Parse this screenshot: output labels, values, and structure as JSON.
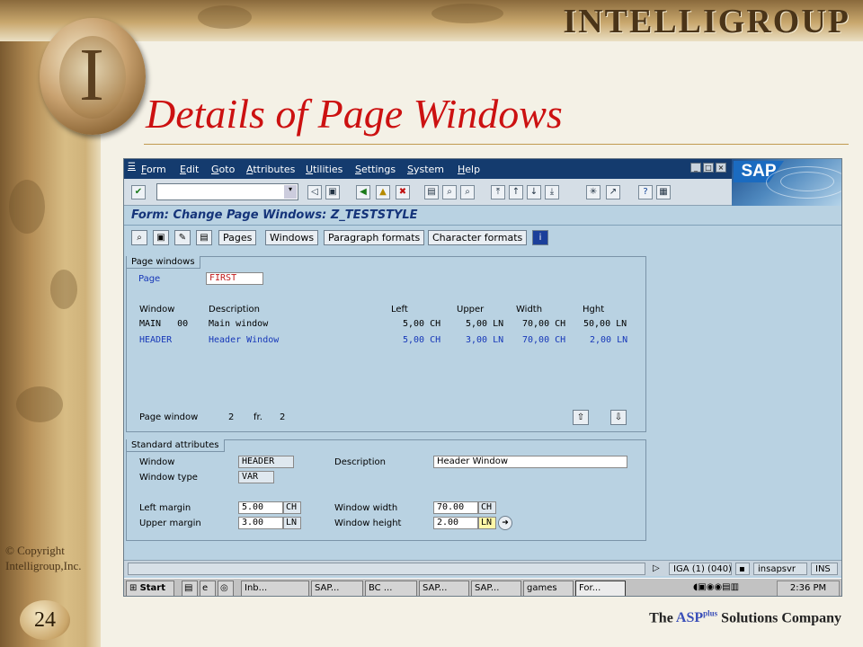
{
  "slide": {
    "brand": "INTELLIGROUP",
    "title": "Details of Page Windows",
    "copyright_line1": "© Copyright",
    "copyright_line2": "Intelligroup,Inc.",
    "page_number": "24",
    "tagline_the": "The ",
    "tagline_asp": "ASP",
    "tagline_plus": "plus",
    "tagline_rest": " Solutions Company"
  },
  "sap": {
    "menu": [
      "Form",
      "Edit",
      "Goto",
      "Attributes",
      "Utilities",
      "Settings",
      "System",
      "Help"
    ],
    "logo_text": "SAP",
    "command_value": "",
    "screen_title": "Form: Change Page Windows: Z_TESTSTYLE",
    "app_buttons": [
      "Pages",
      "Windows",
      "Paragraph formats",
      "Character formats"
    ],
    "page_windows": {
      "group_label": "Page windows",
      "page_label": "Page",
      "page_value": "FIRST",
      "columns": [
        "Window",
        "Description",
        "Left",
        "Upper",
        "Width",
        "Hght"
      ],
      "rows": [
        {
          "window": "MAIN   00",
          "description": "Main window",
          "left": "5,00 CH",
          "upper": "5,00 LN",
          "width": "70,00 CH",
          "height": "50,00 LN",
          "highlight": false
        },
        {
          "window": "HEADER",
          "description": "Header Window",
          "left": "5,00 CH",
          "upper": "3,00 LN",
          "width": "70,00 CH",
          "height": "2,00 LN",
          "highlight": true
        }
      ],
      "footer_label": "Page window",
      "footer_current": "2",
      "footer_fr": "fr.",
      "footer_total": "2"
    },
    "standard_attributes": {
      "group_label": "Standard attributes",
      "window_label": "Window",
      "window_value": "HEADER",
      "window_type_label": "Window type",
      "window_type_value": "VAR",
      "description_label": "Description",
      "description_value": "Header Window",
      "left_margin_label": "Left margin",
      "left_margin_value": "5.00",
      "left_margin_unit": "CH",
      "upper_margin_label": "Upper margin",
      "upper_margin_value": "3.00",
      "upper_margin_unit": "LN",
      "window_width_label": "Window width",
      "window_width_value": "70.00",
      "window_width_unit": "CH",
      "window_height_label": "Window height",
      "window_height_value": "2.00",
      "window_height_unit": "LN"
    },
    "status": {
      "system": "IGA (1) (040)",
      "server": "insapsvr",
      "mode": "INS"
    },
    "taskbar": {
      "start": "Start",
      "tasks": [
        "Inb...",
        "SAP...",
        "BC ...",
        "SAP...",
        "SAP...",
        "games",
        "For..."
      ],
      "clock": "2:36 PM"
    }
  },
  "colors": {
    "title_red": "#cc1111",
    "sap_menu_bg": "#143b6e",
    "sap_screen_bg": "#b9d2e2",
    "highlight_blue": "#1637b8"
  }
}
